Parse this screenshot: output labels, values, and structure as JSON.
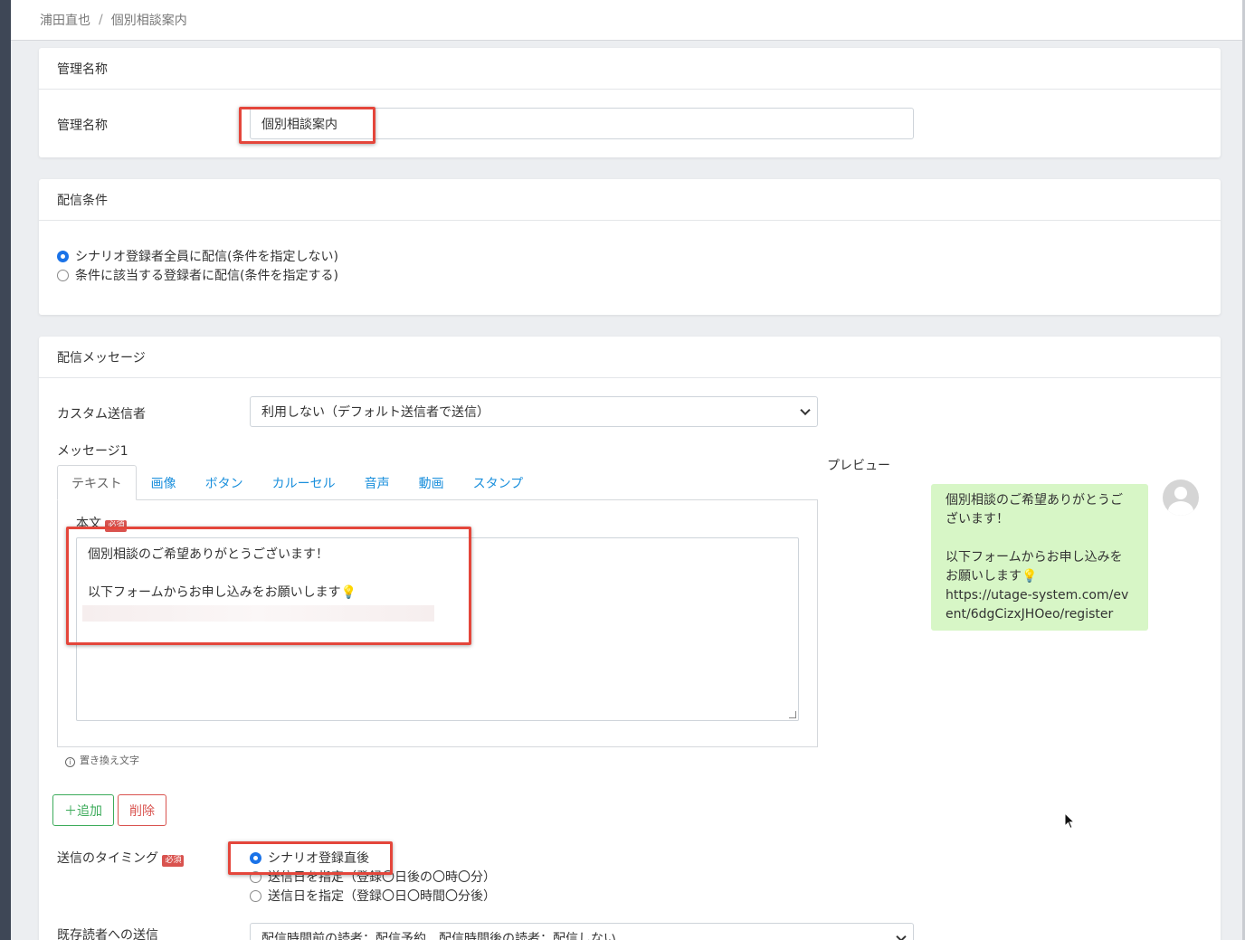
{
  "breadcrumb": {
    "items": [
      "浦田直也",
      "個別相談案内"
    ],
    "separator": "/"
  },
  "management": {
    "header": "管理名称",
    "label": "管理名称",
    "value": "個別相談案内"
  },
  "delivery_condition": {
    "header": "配信条件",
    "options": [
      {
        "label": "シナリオ登録者全員に配信(条件を指定しない)",
        "checked": true
      },
      {
        "label": "条件に該当する登録者に配信(条件を指定する)",
        "checked": false
      }
    ]
  },
  "delivery_message": {
    "header": "配信メッセージ",
    "custom_sender_label": "カスタム送信者",
    "custom_sender_value": "利用しない（デフォルト送信者で送信）",
    "message_label": "メッセージ1",
    "tabs": [
      "テキスト",
      "画像",
      "ボタン",
      "カルーセル",
      "音声",
      "動画",
      "スタンプ"
    ],
    "active_tab": "テキスト",
    "body_label": "本文",
    "required_badge": "必須",
    "body_lines": [
      "個別相談のご希望ありがとうございます！",
      "",
      "以下フォームからお申し込みをお願いします💡"
    ],
    "replace_text_link": "置き換え文字",
    "add_button": "＋追加",
    "delete_button": "削除",
    "preview_label": "プレビュー",
    "preview_text": "個別相談のご希望ありがとうございます！\n\n以下フォームからお申し込みをお願いします💡\nhttps://utage-system.com/event/6dgCizxJHOeo/register"
  },
  "timing": {
    "label": "送信のタイミング",
    "required_badge": "必須",
    "options": [
      {
        "label": "シナリオ登録直後",
        "checked": true
      },
      {
        "label": "送信日を指定（登録〇日後の〇時〇分）",
        "checked": false
      },
      {
        "label": "送信日を指定（登録〇日〇時間〇分後）",
        "checked": false
      }
    ]
  },
  "existing_readers": {
    "label": "既存読者への送信",
    "value": "配信時間前の読者：配信予約、配信時間後の読者：配信しない"
  },
  "colors": {
    "accent": "#1a73e8",
    "highlight": "#e4463b",
    "bubble": "#d7f6c6",
    "add": "#3cab5a",
    "delete": "#d9534f"
  }
}
